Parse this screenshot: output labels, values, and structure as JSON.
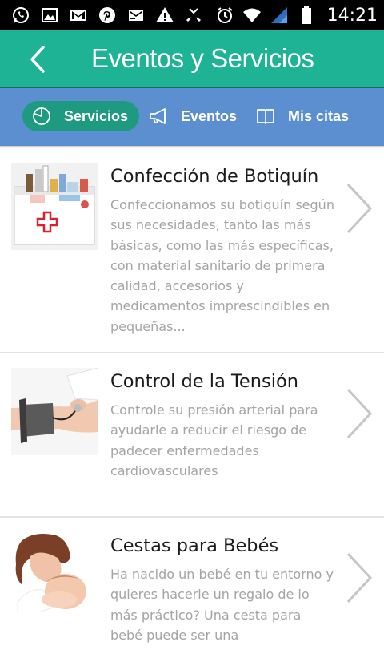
{
  "status_bar": {
    "time": "14:21",
    "left_icons": [
      "whatsapp-icon",
      "image-icon",
      "gmail-icon",
      "pinterest-icon",
      "mail-icon",
      "warning-icon",
      "missed-call-icon"
    ],
    "right_icons": [
      "alarm-icon",
      "wifi-icon",
      "signal-icon",
      "battery-icon"
    ]
  },
  "header": {
    "title": "Eventos y Servicios",
    "back_icon": "back-arrow-icon"
  },
  "tabs": [
    {
      "label": "Servicios",
      "icon": "pie-chart-icon",
      "active": true
    },
    {
      "label": "Eventos",
      "icon": "megaphone-icon",
      "active": false
    },
    {
      "label": "Mis citas",
      "icon": "book-icon",
      "active": false
    }
  ],
  "items": [
    {
      "title": "Confección de Botiquín",
      "description": "Confeccionamos su botiquín según sus necesidades, tanto las más básicas, como las más específicas, con material sanitario de primera calidad, accesorios y medicamentos imprescindibles en pequeñas...",
      "thumbnail": "first-aid-kit-image"
    },
    {
      "title": "Control de la Tensión",
      "description": "Controle su presión arterial para ayudarle a reducir el riesgo de padecer enfermedades cardiovasculares",
      "thumbnail": "blood-pressure-image"
    },
    {
      "title": "Cestas para Bebés",
      "description": "Ha nacido un bebé en tu entorno y quieres hacerle un regalo de lo más práctico? Una cesta para bebé puede ser una",
      "thumbnail": "mother-baby-image"
    }
  ],
  "colors": {
    "header_bg": "#1db394",
    "tabbar_bg": "#5c8fcf",
    "active_tab_bg": "#1d9a7f",
    "title_text": "#1a1a1a",
    "desc_text": "#a4a4a4"
  }
}
